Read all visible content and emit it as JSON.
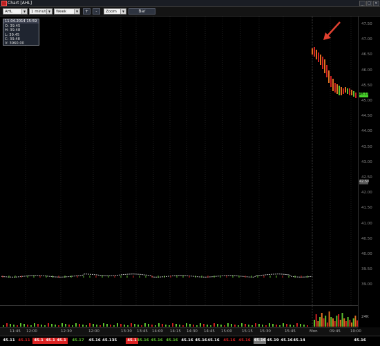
{
  "window": {
    "title": "Chart [AHL]",
    "controls": [
      "_",
      "□",
      "×"
    ]
  },
  "toolbar": {
    "symbol": "AHL",
    "interval": "1 minute",
    "range": "Week",
    "zoom_in": "+",
    "zoom_out": "-",
    "zoom_label": "Zoom",
    "style_button": "Bar"
  },
  "info_box": {
    "header": "11.04.2014 15:59",
    "open": "O: 39.45",
    "high": "H: 39.48",
    "low": "L: 39.45",
    "close": "C: 39.48",
    "volume": "V: 3960.00"
  },
  "price_axis": {
    "ticks": [
      "47.50",
      "47.00",
      "46.50",
      "46.00",
      "45.50",
      "45.00",
      "44.50",
      "44.00",
      "43.50",
      "43.00",
      "42.50",
      "42.00",
      "41.50",
      "41.00",
      "40.50",
      "40.00",
      "39.50",
      "39.00"
    ],
    "last_price_tag": "45.10",
    "gray_tag": "42.50",
    "volume_label": "24K"
  },
  "time_axis": {
    "ticks": [
      "11:45",
      "12:00",
      "12:30",
      "12:00",
      "13:30",
      "13:45",
      "14:00",
      "14:15",
      "14:30",
      "14:45",
      "15:00",
      "15:15",
      "15:30",
      "15:45",
      "Mon",
      "09:45",
      "10:00"
    ]
  },
  "ticker_strip": {
    "cells": [
      "45.11",
      "45.11",
      "45.1",
      "45.1",
      "45.1",
      "45.17",
      "45.16",
      "45.135",
      "45.1",
      "45.16",
      "45.16",
      "45.16",
      "45.16",
      "45.16",
      "45.16",
      "45.16",
      "45.16",
      "45.16",
      "45.19",
      "45.16",
      "45.14",
      "45.16"
    ]
  },
  "colors": {
    "background": "#000000",
    "grid": "#1c1c1c",
    "up": "#5ec22e",
    "down": "#d02020",
    "bar_orange": "#e07020",
    "arrow": "#e04030",
    "last_tag": "#49d62b"
  },
  "icons": {
    "app": "chart-app-icon",
    "arrow": "red-annotation-arrow"
  }
}
